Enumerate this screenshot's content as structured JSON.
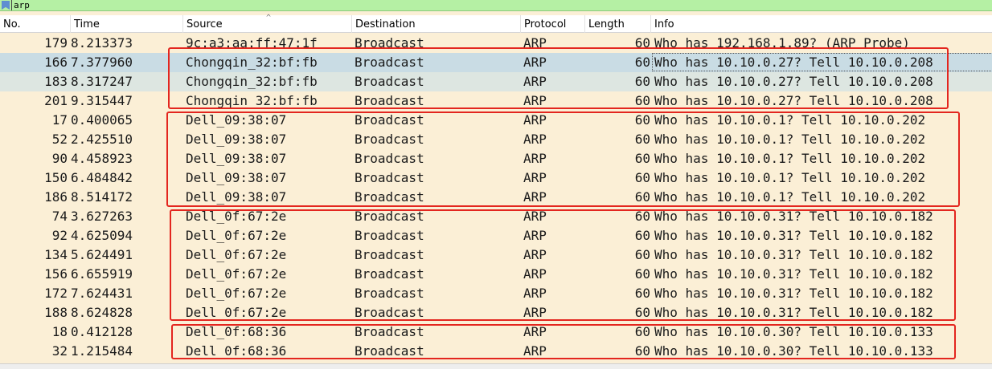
{
  "filter": {
    "text": "arp"
  },
  "columns": {
    "no": "No.",
    "time": "Time",
    "source": "Source",
    "destination": "Destination",
    "protocol": "Protocol",
    "length": "Length",
    "info": "Info"
  },
  "sort_indicator": "^",
  "selected_row": 1,
  "rows": [
    {
      "no": "179",
      "time": "8.213373",
      "source": "9c:a3:aa:ff:47:1f",
      "destination": "Broadcast",
      "protocol": "ARP",
      "length": "60",
      "info": "Who has 192.168.1.89? (ARP Probe)"
    },
    {
      "no": "166",
      "time": "7.377960",
      "source": "Chongqin_32:bf:fb",
      "destination": "Broadcast",
      "protocol": "ARP",
      "length": "60",
      "info": "Who has 10.10.0.27? Tell 10.10.0.208"
    },
    {
      "no": "183",
      "time": "8.317247",
      "source": "Chongqin_32:bf:fb",
      "destination": "Broadcast",
      "protocol": "ARP",
      "length": "60",
      "info": "Who has 10.10.0.27? Tell 10.10.0.208"
    },
    {
      "no": "201",
      "time": "9.315447",
      "source": "Chongqin_32:bf:fb",
      "destination": "Broadcast",
      "protocol": "ARP",
      "length": "60",
      "info": "Who has 10.10.0.27? Tell 10.10.0.208"
    },
    {
      "no": "17",
      "time": "0.400065",
      "source": "Dell_09:38:07",
      "destination": "Broadcast",
      "protocol": "ARP",
      "length": "60",
      "info": "Who has 10.10.0.1? Tell 10.10.0.202"
    },
    {
      "no": "52",
      "time": "2.425510",
      "source": "Dell_09:38:07",
      "destination": "Broadcast",
      "protocol": "ARP",
      "length": "60",
      "info": "Who has 10.10.0.1? Tell 10.10.0.202"
    },
    {
      "no": "90",
      "time": "4.458923",
      "source": "Dell_09:38:07",
      "destination": "Broadcast",
      "protocol": "ARP",
      "length": "60",
      "info": "Who has 10.10.0.1? Tell 10.10.0.202"
    },
    {
      "no": "150",
      "time": "6.484842",
      "source": "Dell_09:38:07",
      "destination": "Broadcast",
      "protocol": "ARP",
      "length": "60",
      "info": "Who has 10.10.0.1? Tell 10.10.0.202"
    },
    {
      "no": "186",
      "time": "8.514172",
      "source": "Dell_09:38:07",
      "destination": "Broadcast",
      "protocol": "ARP",
      "length": "60",
      "info": "Who has 10.10.0.1? Tell 10.10.0.202"
    },
    {
      "no": "74",
      "time": "3.627263",
      "source": "Dell_0f:67:2e",
      "destination": "Broadcast",
      "protocol": "ARP",
      "length": "60",
      "info": "Who has 10.10.0.31? Tell 10.10.0.182"
    },
    {
      "no": "92",
      "time": "4.625094",
      "source": "Dell_0f:67:2e",
      "destination": "Broadcast",
      "protocol": "ARP",
      "length": "60",
      "info": "Who has 10.10.0.31? Tell 10.10.0.182"
    },
    {
      "no": "134",
      "time": "5.624491",
      "source": "Dell_0f:67:2e",
      "destination": "Broadcast",
      "protocol": "ARP",
      "length": "60",
      "info": "Who has 10.10.0.31? Tell 10.10.0.182"
    },
    {
      "no": "156",
      "time": "6.655919",
      "source": "Dell_0f:67:2e",
      "destination": "Broadcast",
      "protocol": "ARP",
      "length": "60",
      "info": "Who has 10.10.0.31? Tell 10.10.0.182"
    },
    {
      "no": "172",
      "time": "7.624431",
      "source": "Dell_0f:67:2e",
      "destination": "Broadcast",
      "protocol": "ARP",
      "length": "60",
      "info": "Who has 10.10.0.31? Tell 10.10.0.182"
    },
    {
      "no": "188",
      "time": "8.624828",
      "source": "Dell_0f:67:2e",
      "destination": "Broadcast",
      "protocol": "ARP",
      "length": "60",
      "info": "Who has 10.10.0.31? Tell 10.10.0.182"
    },
    {
      "no": "18",
      "time": "0.412128",
      "source": "Dell_0f:68:36",
      "destination": "Broadcast",
      "protocol": "ARP",
      "length": "60",
      "info": "Who has 10.10.0.30? Tell 10.10.0.133"
    },
    {
      "no": "32",
      "time": "1.215484",
      "source": "Dell_0f:68:36",
      "destination": "Broadcast",
      "protocol": "ARP",
      "length": "60",
      "info": "Who has 10.10.0.30? Tell 10.10.0.133"
    }
  ],
  "colors": {
    "row_background": "#fbefd6",
    "selected_row": "#c9dce4",
    "annotation_box": "#e3261f",
    "filter_bar": "#b5f0a4"
  }
}
